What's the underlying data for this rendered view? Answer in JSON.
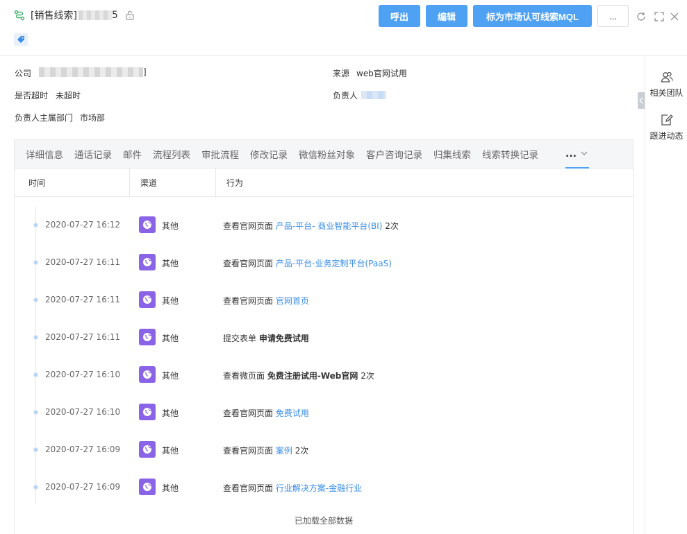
{
  "header": {
    "title_prefix": "[销售线索]",
    "title_suffix": "5",
    "buttons": {
      "call": "呼出",
      "edit": "编辑",
      "mark_mql": "标为市场认可线索MQL",
      "more": "..."
    }
  },
  "info": {
    "company_label": "公司",
    "company_tail": "]",
    "source_label": "来源",
    "source_value": "web官网试用",
    "timeout_label": "是否超时",
    "timeout_value": "未超时",
    "owner_label": "负责人",
    "dept_label": "负责人主属部门",
    "dept_value": "市场部"
  },
  "rail": {
    "team": "相关团队",
    "follow": "跟进动态"
  },
  "tabs": [
    "详细信息",
    "通话记录",
    "邮件",
    "流程列表",
    "审批流程",
    "修改记录",
    "微信粉丝对象",
    "客户咨询记录",
    "归集线索",
    "线索转换记录"
  ],
  "tab_more": "...",
  "columns": {
    "time": "时间",
    "channel": "渠道",
    "action": "行为"
  },
  "rows": [
    {
      "time": "2020-07-27 16:12",
      "channel": "其他",
      "verb": "查看官网页面",
      "target": "产品-平台- 商业智能平台(BI)",
      "target_style": "link",
      "count": "2次"
    },
    {
      "time": "2020-07-27 16:11",
      "channel": "其他",
      "verb": "查看官网页面",
      "target": "产品-平台-业务定制平台(PaaS)",
      "target_style": "link",
      "count": ""
    },
    {
      "time": "2020-07-27 16:11",
      "channel": "其他",
      "verb": "查看官网页面",
      "target": "官网首页",
      "target_style": "link",
      "count": ""
    },
    {
      "time": "2020-07-27 16:11",
      "channel": "其他",
      "verb": "提交表单",
      "target": "申请免费试用",
      "target_style": "strong",
      "count": ""
    },
    {
      "time": "2020-07-27 16:10",
      "channel": "其他",
      "verb": "查看微页面",
      "target": "免费注册试用-Web官网",
      "target_style": "strong",
      "count": "2次"
    },
    {
      "time": "2020-07-27 16:10",
      "channel": "其他",
      "verb": "查看官网页面",
      "target": "免费试用",
      "target_style": "link",
      "count": ""
    },
    {
      "time": "2020-07-27 16:09",
      "channel": "其他",
      "verb": "查看官网页面",
      "target": "案例",
      "target_style": "link",
      "count": "2次"
    },
    {
      "time": "2020-07-27 16:09",
      "channel": "其他",
      "verb": "查看官网页面",
      "target": "行业解决方案-金融行业",
      "target_style": "link",
      "count": ""
    }
  ],
  "footer": {
    "loaded": "已加载全部数据"
  },
  "colors": {
    "accent": "#4ea1f3",
    "link": "#3a8ee6",
    "channel_icon": "#8b63e6",
    "lead_icon": "#3db26c"
  },
  "icons": [
    "lead-icon",
    "lock-icon",
    "tag-icon",
    "refresh-icon",
    "fullscreen-icon",
    "close-icon",
    "team-icon",
    "edit-note-icon",
    "globe-icon",
    "chevron-down-icon",
    "chevron-left-icon"
  ]
}
